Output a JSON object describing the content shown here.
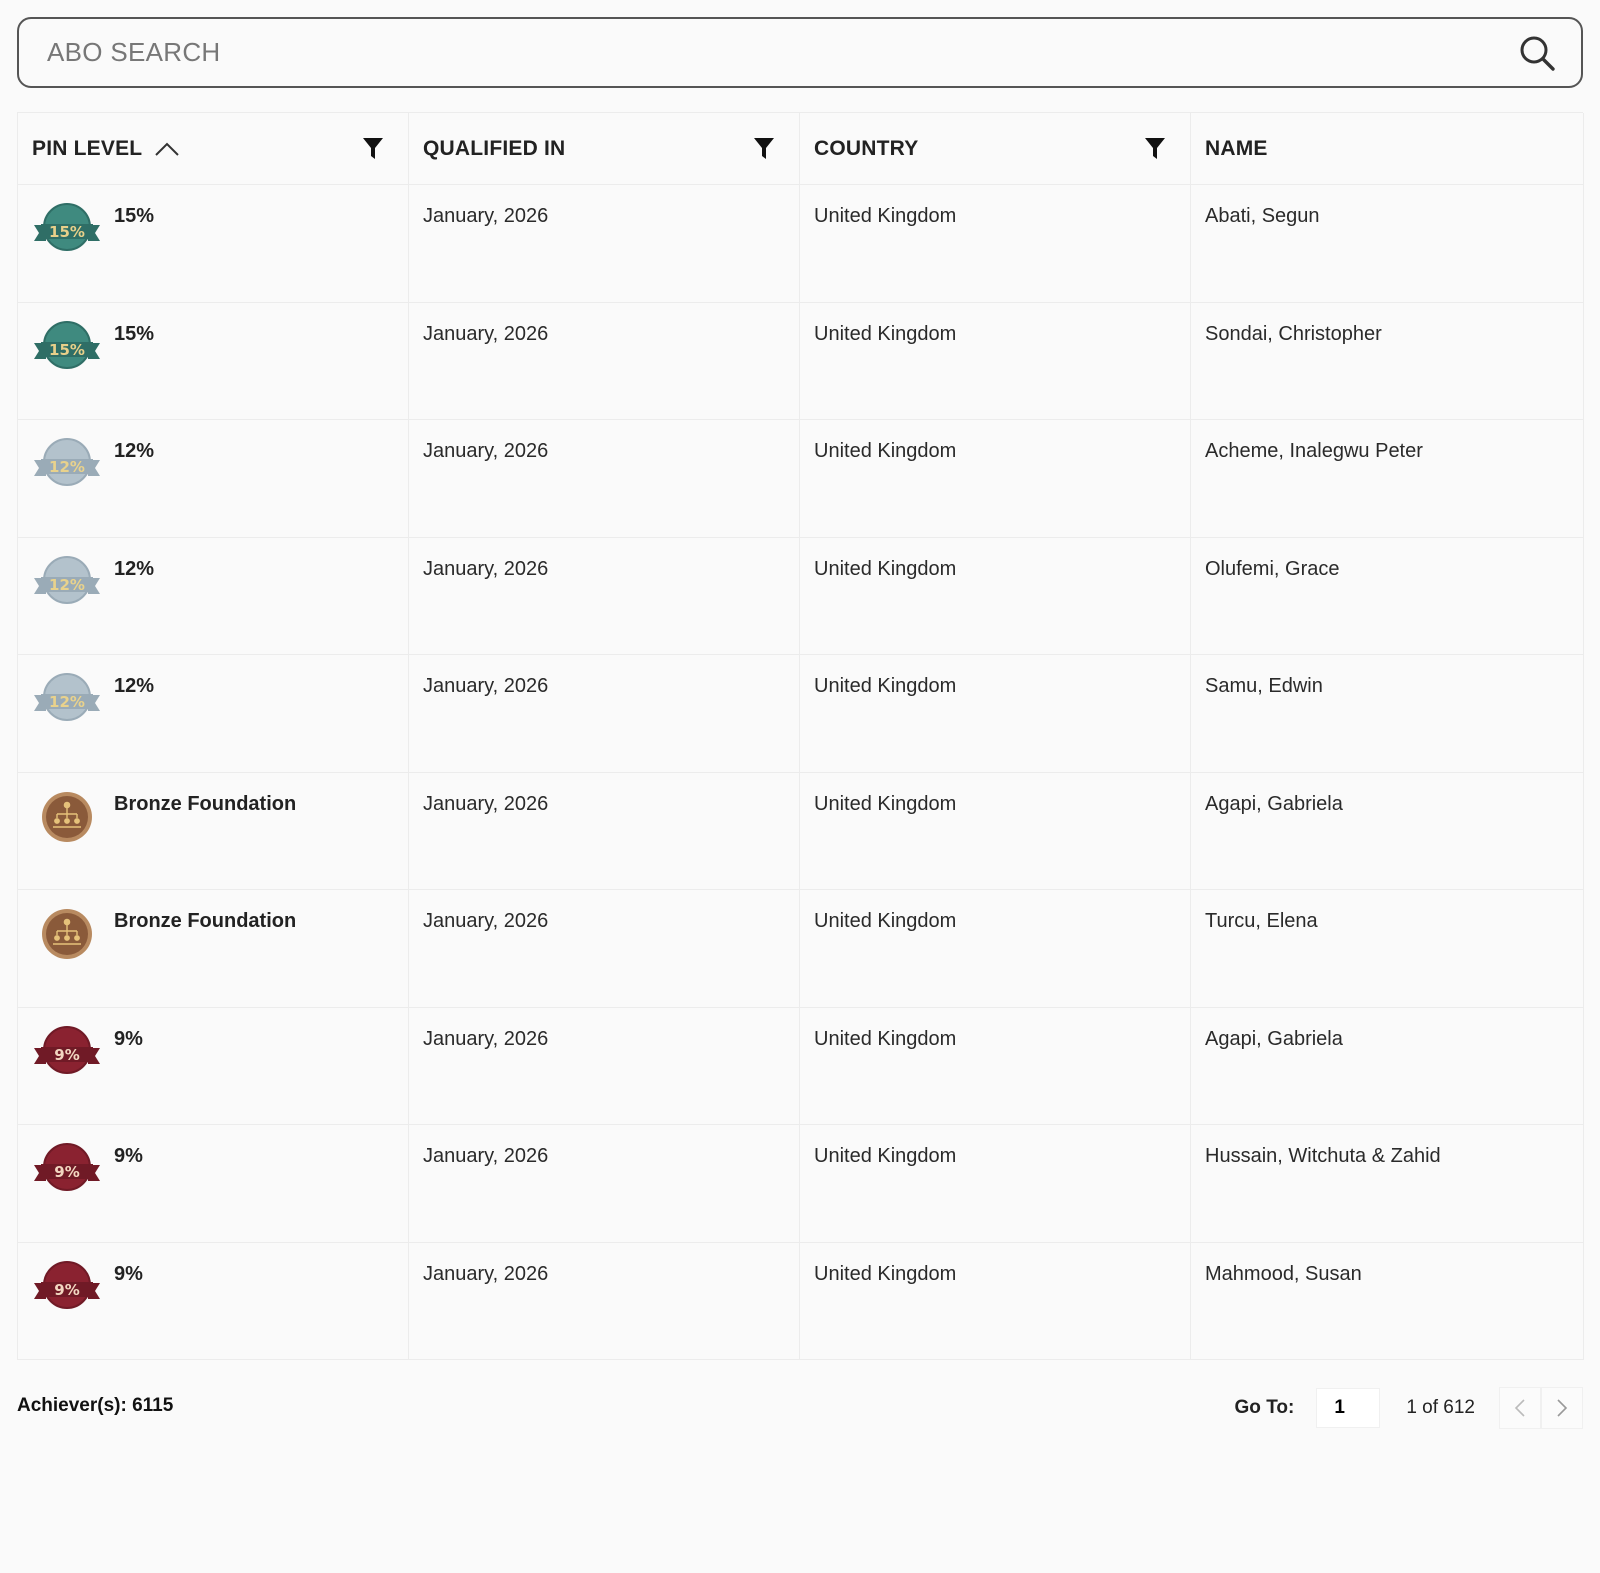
{
  "search": {
    "placeholder": "ABO SEARCH",
    "value": ""
  },
  "table": {
    "columns": [
      {
        "label": "PIN LEVEL",
        "sort": "ascending"
      },
      {
        "label": "QUALIFIED IN"
      },
      {
        "label": "COUNTRY"
      },
      {
        "label": "NAME"
      }
    ],
    "rows": [
      {
        "pin": "15%",
        "badge": "badge-15-icon",
        "qualified": "January, 2026",
        "country": "United Kingdom",
        "name": "Abati, Segun"
      },
      {
        "pin": "15%",
        "badge": "badge-15-icon",
        "qualified": "January, 2026",
        "country": "United Kingdom",
        "name": "Sondai, Christopher"
      },
      {
        "pin": "12%",
        "badge": "badge-12-icon",
        "qualified": "January, 2026",
        "country": "United Kingdom",
        "name": "Acheme, Inalegwu Peter"
      },
      {
        "pin": "12%",
        "badge": "badge-12-icon",
        "qualified": "January, 2026",
        "country": "United Kingdom",
        "name": "Olufemi, Grace"
      },
      {
        "pin": "12%",
        "badge": "badge-12-icon",
        "qualified": "January, 2026",
        "country": "United Kingdom",
        "name": "Samu, Edwin"
      },
      {
        "pin": "Bronze Foundation",
        "badge": "bronze-foundation-icon",
        "qualified": "January, 2026",
        "country": "United Kingdom",
        "name": "Agapi, Gabriela"
      },
      {
        "pin": "Bronze Foundation",
        "badge": "bronze-foundation-icon",
        "qualified": "January, 2026",
        "country": "United Kingdom",
        "name": "Turcu, Elena"
      },
      {
        "pin": "9%",
        "badge": "badge-9-icon",
        "qualified": "January, 2026",
        "country": "United Kingdom",
        "name": "Agapi, Gabriela"
      },
      {
        "pin": "9%",
        "badge": "badge-9-icon",
        "qualified": "January, 2026",
        "country": "United Kingdom",
        "name": "Hussain, Witchuta & Zahid"
      },
      {
        "pin": "9%",
        "badge": "badge-9-icon",
        "qualified": "January, 2026",
        "country": "United Kingdom",
        "name": "Mahmood, Susan"
      }
    ]
  },
  "badges": {
    "15%": {
      "text": "15%",
      "fill": "#3f8a7f",
      "ribbon": "#2f6e66",
      "textColor": "#e8d08a"
    },
    "12%": {
      "text": "12%",
      "fill": "#b3c2cc",
      "ribbon": "#9aabb7",
      "textColor": "#e9d28c"
    },
    "9%": {
      "text": "9%",
      "fill": "#8a2230",
      "ribbon": "#701a26",
      "textColor": "#f2d6c0"
    },
    "Bronze Foundation": {
      "fill": "#8a5a3a",
      "ring": "#b88a60"
    }
  },
  "footer": {
    "achievers": "Achiever(s): 6115",
    "goto_label": "Go To:",
    "goto_value": "1",
    "page_count": "1 of 612"
  }
}
